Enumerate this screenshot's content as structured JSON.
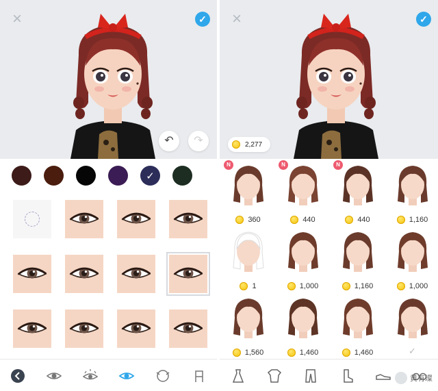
{
  "left_panel": {
    "swatches": [
      {
        "color": "#3c1b18"
      },
      {
        "color": "#4a1d0e"
      },
      {
        "color": "#060606"
      },
      {
        "color": "#3b1c54"
      },
      {
        "color": "#2c2d59",
        "selected": true
      },
      {
        "color": "#1d2d22"
      }
    ],
    "eye_options": 12,
    "selected_eye": 8,
    "toolbar_icons": [
      "back-icon",
      "eye-style-1-icon",
      "eye-style-2-icon",
      "eye-style-3-icon",
      "eyelash-icon",
      "glasses-stand-icon"
    ],
    "active_toolbar": 3
  },
  "right_panel": {
    "coins": "2,277",
    "hair_items": [
      {
        "price": "360",
        "is_new": true
      },
      {
        "price": "440",
        "is_new": true
      },
      {
        "price": "440",
        "is_new": true
      },
      {
        "price": "1,160",
        "is_new": false
      },
      {
        "price": "1",
        "is_new": false
      },
      {
        "price": "1,000",
        "is_new": false
      },
      {
        "price": "1,160",
        "is_new": false
      },
      {
        "price": "1,000",
        "is_new": false
      },
      {
        "price": "1,560",
        "is_new": false
      },
      {
        "price": "1,460",
        "is_new": false
      },
      {
        "price": "1,460",
        "is_new": false
      },
      {
        "price": "",
        "owned": true
      }
    ],
    "badge_label": "N",
    "toolbar_icons": [
      "dress-icon",
      "shirt-icon",
      "pants-icon",
      "boot-icon",
      "sneaker-icon",
      "glasses-icon"
    ],
    "watermark": "黄有璨"
  },
  "colors": {
    "accent_blue": "#2fa7ea",
    "preview_bg": "#e9ebee",
    "skin": "#f5d6c4",
    "coin": "#f3c100",
    "new_badge": "#ee5a6f"
  }
}
